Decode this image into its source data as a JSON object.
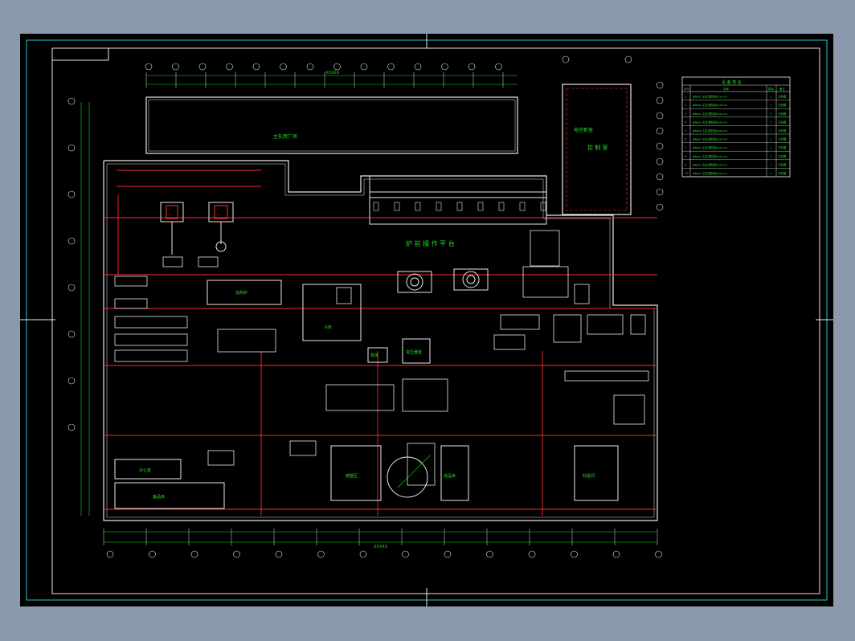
{
  "title_block": {
    "heading": "设 备 表 名",
    "col_no": "序号",
    "col_name": "名称",
    "col_qty": "数量",
    "col_note": "备注",
    "rows": [
      {
        "no": "1",
        "name": "φ6φxx 主轧辊机组xxxx-xx",
        "qty": "1",
        "note": "已购置"
      },
      {
        "no": "2",
        "name": "φ6φxx 主轧辊机组xxxx-xx",
        "qty": "1",
        "note": "已购置"
      },
      {
        "no": "3",
        "name": "φ6φxx 主轧辊机组xxxx-xx",
        "qty": "1",
        "note": "已购置"
      },
      {
        "no": "4",
        "name": "φ6φxx 主轧辊机组xxxx-xx",
        "qty": "1",
        "note": "已购置"
      },
      {
        "no": "5",
        "name": "φ6φxx 主轧辊机组xxxx-xx",
        "qty": "1",
        "note": "已购置"
      },
      {
        "no": "6",
        "name": "φ6φxx 主轧辊机组xxxx-xx",
        "qty": "1",
        "note": "已购置"
      },
      {
        "no": "7",
        "name": "φ6φxx 主轧辊机组xxxx-xx",
        "qty": "1",
        "note": "已购置"
      },
      {
        "no": "8",
        "name": "φ6φxx 主轧辊机组xxxx-xx",
        "qty": "1",
        "note": "已购置"
      },
      {
        "no": "9",
        "name": "φ6φxx 主轧辊机组xxxx-xx",
        "qty": "1",
        "note": "已购置"
      },
      {
        "no": "10",
        "name": "φ6φxx 主轧辊机组xxxx-xx",
        "qty": "1",
        "note": "已购置"
      }
    ]
  },
  "labels": {
    "top_hall": "主轧跨厂房",
    "control_room_title": "电控柜室",
    "control_room_sub": "控 制 室",
    "platform": "炉 前 操 作 平 台",
    "heating_furnace": "加热炉",
    "cooling_bed": "冷床",
    "finishing": "精整区",
    "storage": "成品库",
    "pump_room": "泵房",
    "transformer": "变压器室",
    "roll_shop": "轧辊间",
    "office": "办公室",
    "warehouse": "备品库"
  },
  "dims": {
    "top_total": "XXXXX",
    "bottom_total": "XXXXX",
    "seg": "XXXX"
  }
}
